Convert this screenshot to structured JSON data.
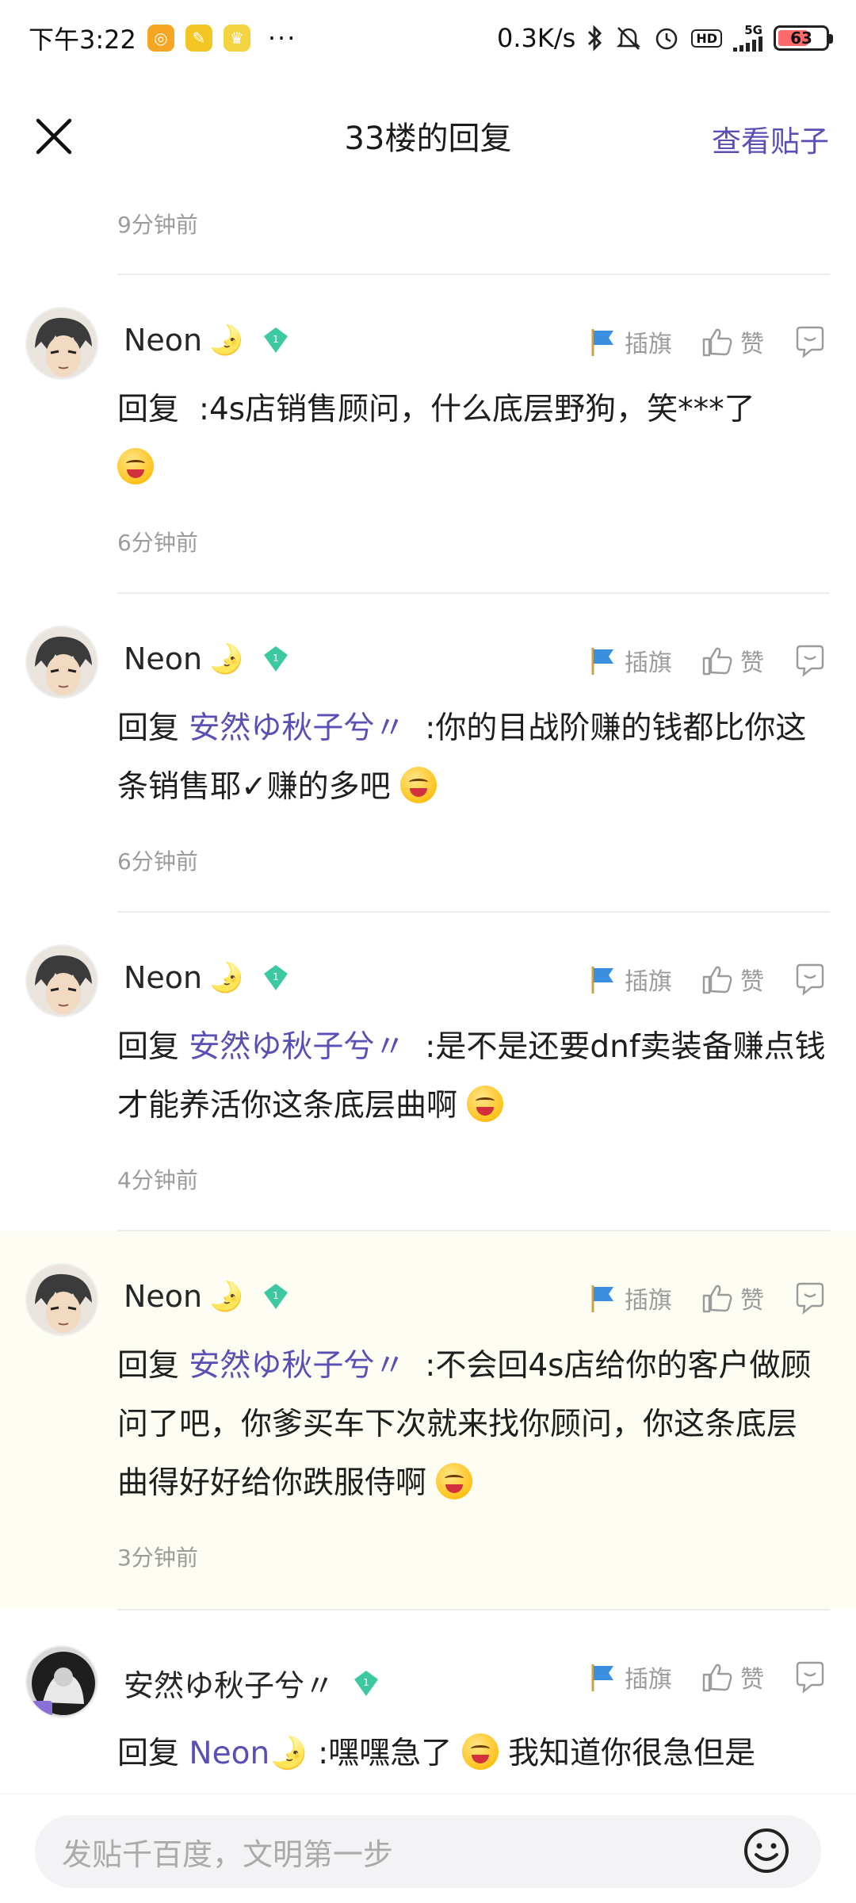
{
  "status_bar": {
    "time": "下午3:22",
    "more": "···",
    "speed": "0.3K/s",
    "network": "5G",
    "hd": "HD",
    "battery": "63",
    "battery_level": 0.63
  },
  "header": {
    "title": "33楼的回复",
    "view_post": "查看贴子"
  },
  "top_time": "9分钟前",
  "replies": [
    {
      "username": "Neon",
      "level": "1",
      "flag_label": "插旗",
      "like_label": "赞",
      "prefix": "回复",
      "mention": "",
      "text": ":4s店销售顾问，什么底层野狗，笑***了",
      "time": "6分钟前"
    },
    {
      "username": "Neon",
      "level": "1",
      "flag_label": "插旗",
      "like_label": "赞",
      "prefix": "回复",
      "mention": "安然ゆ秋子兮〃",
      "text": ":你的目战阶赚的钱都比你这条销售耶✓赚的多吧",
      "time": "6分钟前"
    },
    {
      "username": "Neon",
      "level": "1",
      "flag_label": "插旗",
      "like_label": "赞",
      "prefix": "回复",
      "mention": "安然ゆ秋子兮〃",
      "text": ":是不是还要dnf卖装备赚点钱才能养活你这条底层曲啊",
      "time": "4分钟前"
    },
    {
      "username": "Neon",
      "level": "1",
      "flag_label": "插旗",
      "like_label": "赞",
      "prefix": "回复",
      "mention": "安然ゆ秋子兮〃",
      "text": ":不会回4s店给你的客户做顾问了吧，你爹买车下次就来找你顾问，你这条底层曲得好好给你跌服侍啊",
      "time": "3分钟前"
    },
    {
      "username": "安然ゆ秋子兮〃",
      "level": "1",
      "flag_label": "插旗",
      "like_label": "赞",
      "prefix": "回复",
      "mention": "Neon",
      "text": ":嘿嘿急了",
      "text_after": "我知道你很急但是",
      "time": ""
    }
  ],
  "input": {
    "placeholder": "发贴千百度，文明第一步"
  },
  "colors": {
    "accent": "#5a4fb4",
    "highlight_bg": "#fdfdf3",
    "muted": "#9b9b9b"
  }
}
